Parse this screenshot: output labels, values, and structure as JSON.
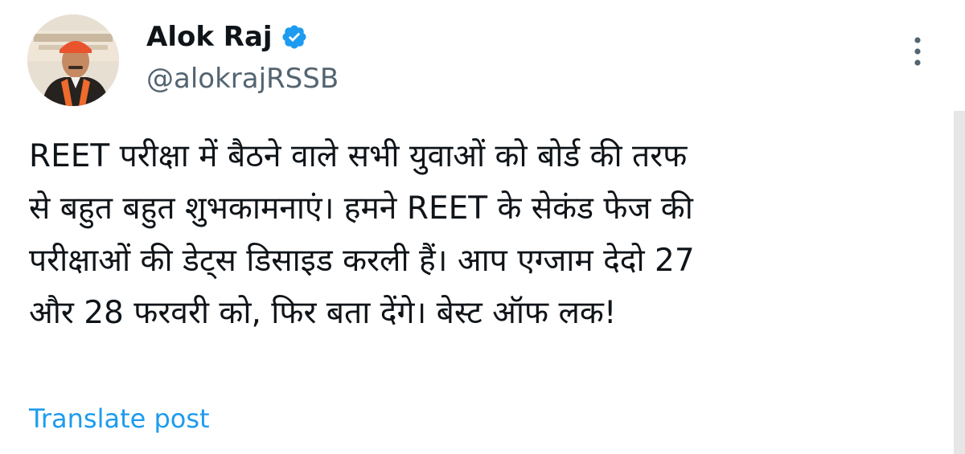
{
  "author": {
    "display_name": "Alok Raj",
    "handle": "@alokrajRSSB",
    "verified_icon": "verified-badge-icon",
    "badge_color": "#1d9bf0"
  },
  "post": {
    "lines": [
      "REET परीक्षा में बैठने वाले सभी युवाओं को बोर्ड की तरफ",
      "से बहुत बहुत शुभकामनाएं। हमने REET के सेकंड फेज की",
      "परीक्षाओं की डेट्स डिसाइड करली हैं। आप एग्जाम देदो 27",
      "और 28 फरवरी को, फिर बता देंगे। बेस्ट ऑफ लक!"
    ]
  },
  "actions": {
    "translate_label": "Translate post",
    "more_icon": "more-vertical-icon"
  },
  "colors": {
    "text_primary": "#0f1419",
    "text_secondary": "#536471",
    "link": "#1d9bf0"
  }
}
